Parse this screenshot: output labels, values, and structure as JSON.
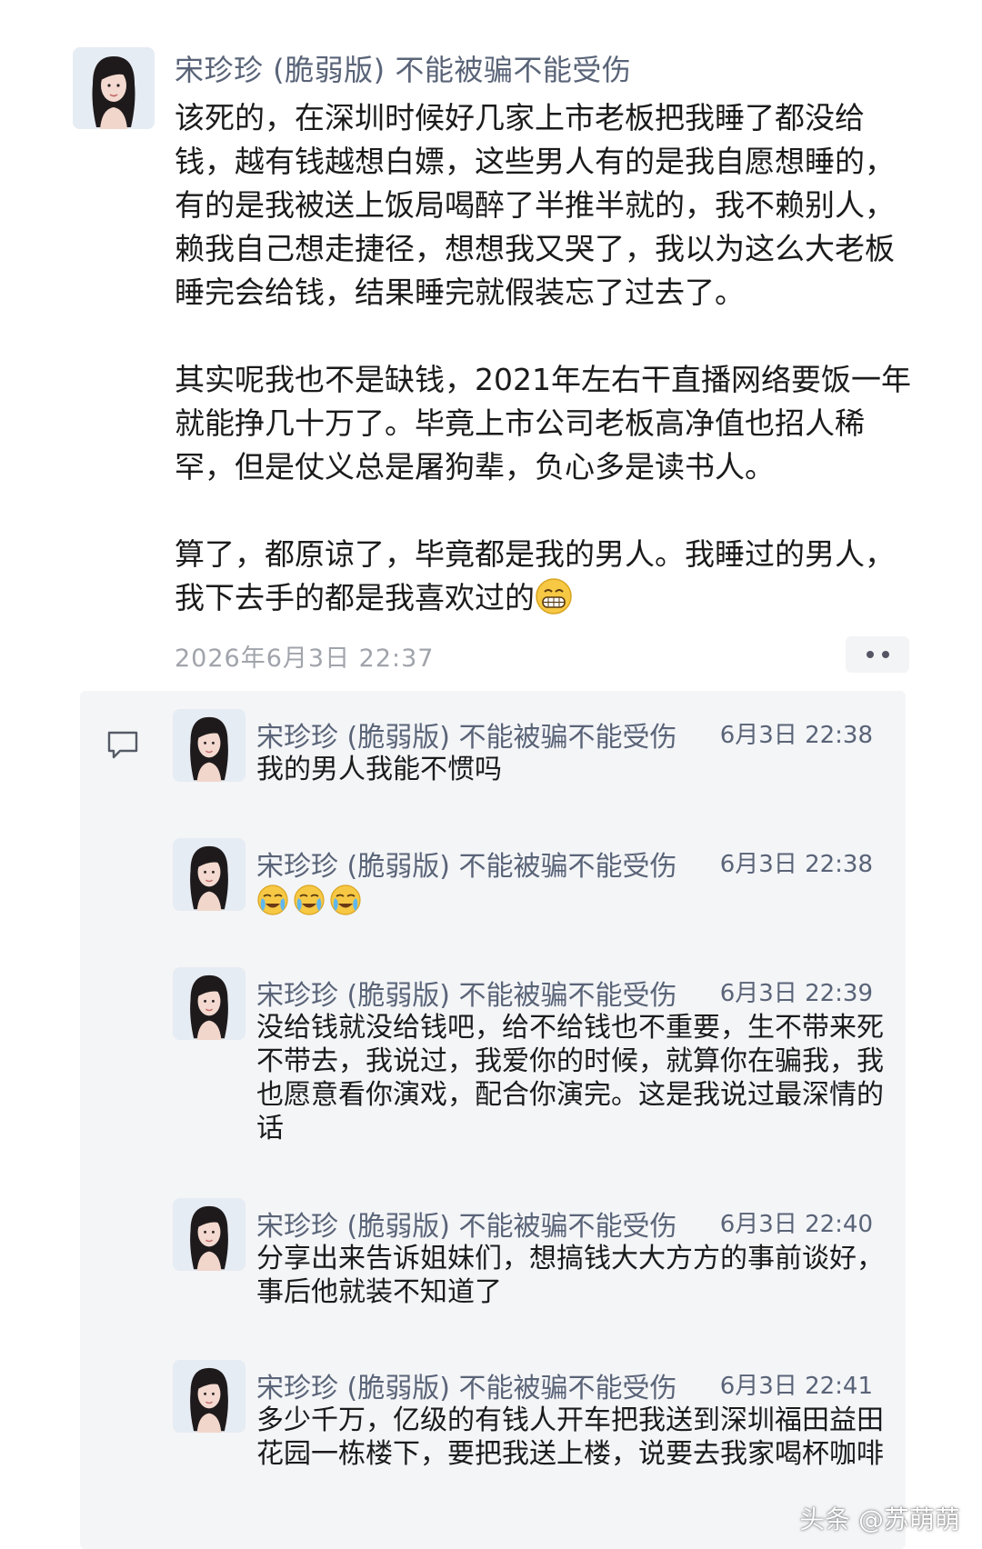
{
  "post": {
    "author": "宋珍珍 (脆弱版) 不能被骗不能受伤",
    "paragraphs": [
      "该死的，在深圳时候好几家上市老板把我睡了都没给钱，越有钱越想白嫖，这些男人有的是我自愿想睡的，有的是我被送上饭局喝醉了半推半就的，我不赖别人，赖我自己想走捷径，想想我又哭了，我以为这么大老板睡完会给钱，结果睡完就假装忘了过去了。",
      "其实呢我也不是缺钱，2021年左右干直播网络要饭一年就能挣几十万了。毕竟上市公司老板高净值也招人稀罕，但是仗义总是屠狗辈，负心多是读书人。",
      "算了，都原谅了，毕竟都是我的男人。我睡过的男人，我下去手的都是我喜欢过的"
    ],
    "end_emoji": "grinning-face-emoji",
    "timestamp": "2026年6月3日 22:37"
  },
  "comments": [
    {
      "author": "宋珍珍 (脆弱版) 不能被骗不能受伤",
      "time": "6月3日 22:38",
      "text": "我的男人我能不惯吗"
    },
    {
      "author": "宋珍珍 (脆弱版) 不能被骗不能受伤",
      "time": "6月3日 22:38",
      "text": "",
      "emojis": [
        "crying-emoji",
        "crying-emoji",
        "crying-emoji"
      ]
    },
    {
      "author": "宋珍珍 (脆弱版) 不能被骗不能受伤",
      "time": "6月3日 22:39",
      "text": "没给钱就没给钱吧，给不给钱也不重要，生不带来死不带去，我说过，我爱你的时候，就算你在骗我，我也愿意看你演戏，配合你演完。这是我说过最深情的话"
    },
    {
      "author": "宋珍珍 (脆弱版) 不能被骗不能受伤",
      "time": "6月3日 22:40",
      "text": "分享出来告诉姐妹们，想搞钱大大方方的事前谈好，事后他就装不知道了"
    },
    {
      "author": "宋珍珍 (脆弱版) 不能被骗不能受伤",
      "time": "6月3日 22:41",
      "text": "多少千万，亿级的有钱人开车把我送到深圳福田益田花园一栋楼下，要把我送上楼，说要去我家喝杯咖啡"
    }
  ],
  "watermark": "头条 @苏萌萌",
  "icons": {
    "comment": "comment-bubble-icon",
    "more": "more-dots-icon"
  }
}
